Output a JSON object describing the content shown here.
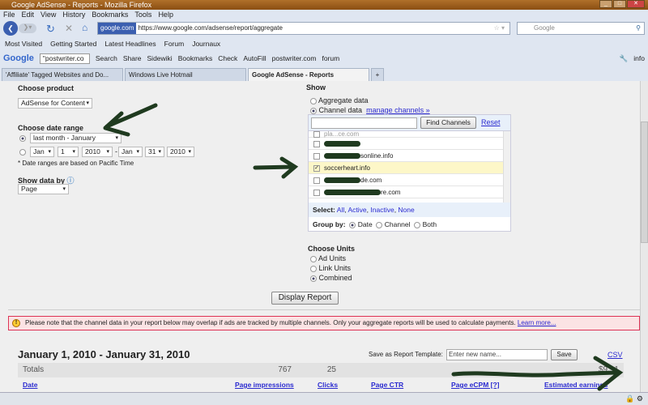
{
  "window": {
    "title": "Google AdSense - Reports - Mozilla Firefox"
  },
  "menu": [
    "File",
    "Edit",
    "View",
    "History",
    "Bookmarks",
    "Tools",
    "Help"
  ],
  "nav": {
    "site_badge": "google.com",
    "url": "https://www.google.com/adsense/report/aggregate",
    "search_placeholder": "Google"
  },
  "bookmarks": [
    "Most Visited",
    "Getting Started",
    "Latest Headlines",
    "Forum",
    "Journaux"
  ],
  "gtoolbar": {
    "query": "\"postwriter.co",
    "items": [
      "Search",
      "Share",
      "Sidewiki",
      "Bookmarks",
      "Check",
      "AutoFill",
      "postwriter.com",
      "forum"
    ],
    "account": "info"
  },
  "tabs": [
    "'Affiliate' Tagged Websites and Do...",
    "Windows Live Hotmail",
    "Google AdSense - Reports"
  ],
  "left": {
    "product_label": "Choose product",
    "product": "AdSense for Content",
    "date_label": "Choose date range",
    "preset": "last month - January",
    "from_month": "Jan",
    "from_day": "1",
    "from_year": "2010",
    "dash": "-",
    "to_month": "Jan",
    "to_day": "31",
    "to_year": "2010",
    "note": "* Date ranges are based on Pacific Time",
    "show_by_label": "Show data by",
    "show_by": "Page"
  },
  "right": {
    "show_label": "Show",
    "aggregate": "Aggregate data",
    "channel": "Channel data",
    "manage": "manage channels »",
    "find_btn": "Find Channels",
    "reset": "Reset",
    "channels": [
      {
        "name": "pla...ce.com",
        "checked": false
      },
      {
        "name": "",
        "checked": false
      },
      {
        "name": "sonline.info",
        "checked": false
      },
      {
        "name": "soccerheart.info",
        "checked": true
      },
      {
        "name": "de.com",
        "checked": false
      },
      {
        "name": "re.com",
        "checked": false
      }
    ],
    "select_label": "Select:",
    "select_opts": [
      "All",
      "Active",
      "Inactive",
      "None"
    ],
    "group_label": "Group by:",
    "group_opts": [
      "Date",
      "Channel",
      "Both"
    ],
    "units_label": "Choose Units",
    "units": [
      "Ad Units",
      "Link Units",
      "Combined"
    ]
  },
  "display_btn": "Display Report",
  "warning": {
    "text": "Please note that the channel data in your report below may overlap if ads are tracked by multiple channels. Only your aggregate reports will be used to calculate payments.",
    "link": "Learn more..."
  },
  "report": {
    "title": "January 1, 2010 - January 31, 2010",
    "save_label": "Save as Report Template:",
    "save_placeholder": "Enter new name...",
    "save_btn": "Save",
    "csv": "CSV",
    "totals": {
      "label": "Totals",
      "impressions": "767",
      "clicks": "25",
      "earnings": "$9.91"
    },
    "columns": [
      "Date",
      "Page impressions",
      "Clicks",
      "Page CTR",
      "Page eCPM [?]",
      "Estimated earnings"
    ]
  }
}
